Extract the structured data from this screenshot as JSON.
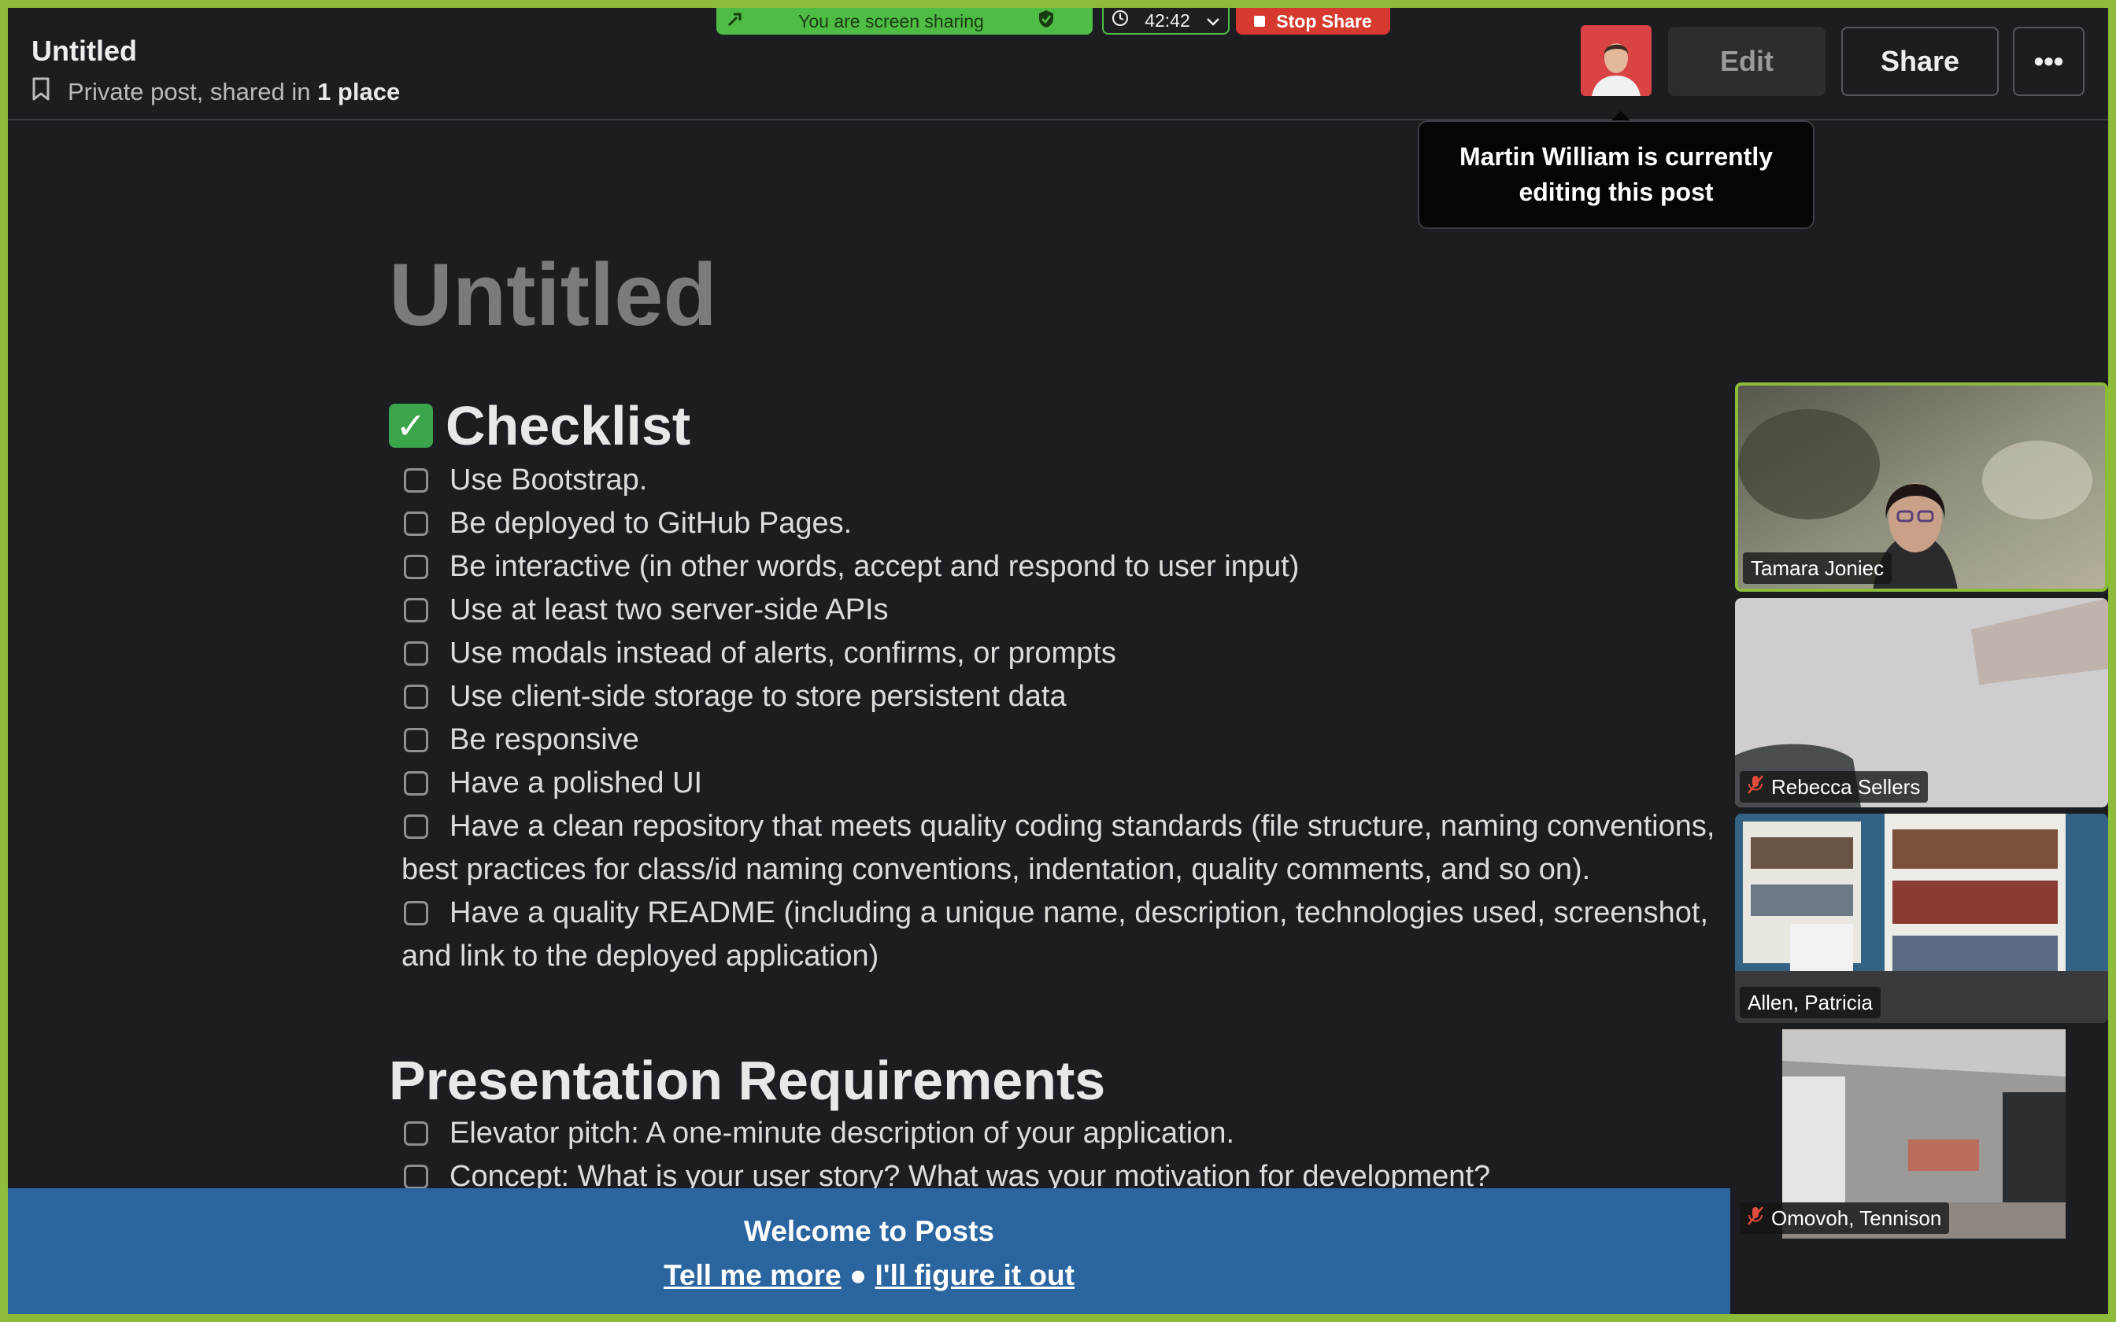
{
  "header": {
    "title": "Untitled",
    "subtitle_prefix": "Private post, shared in",
    "subtitle_bold": "1 place",
    "edit_label": "Edit",
    "share_label": "Share",
    "more_label": "•••"
  },
  "tooltip": {
    "text": "Martin William is currently editing this post"
  },
  "screen_share": {
    "status": "You are screen sharing",
    "timer": "42:42",
    "stop_label": "Stop Share"
  },
  "post": {
    "title": "Untitled",
    "sections": [
      {
        "heading": "Checklist",
        "items": [
          "Use Bootstrap.",
          "Be deployed to GitHub Pages.",
          "Be interactive (in other words, accept and respond to user input)",
          "Use at least two server-side APIs",
          "Use modals instead of alerts, confirms, or prompts",
          "Use client-side storage to store persistent data",
          "Be responsive",
          "Have a polished UI",
          "Have a clean repository that meets quality coding standards (file structure, naming conventions, best practices for class/id naming conventions, indentation, quality comments, and so on).",
          "Have a quality README (including a unique name, description, technologies used, screenshot, and link to the deployed application)"
        ]
      },
      {
        "heading": "Presentation Requirements",
        "items": [
          "Elevator pitch: A one-minute description of your application.",
          "Concept: What is your user story? What was your motivation for development?"
        ]
      }
    ]
  },
  "participants": [
    {
      "name": "Tamara Joniec",
      "muted": false,
      "active": true
    },
    {
      "name": "Rebecca Sellers",
      "muted": true,
      "active": false
    },
    {
      "name": "Allen, Patricia",
      "muted": false,
      "active": false
    },
    {
      "name": "Omovoh, Tennison",
      "muted": true,
      "active": false
    }
  ],
  "banner": {
    "title": "Welcome to Posts",
    "link_more": "Tell me more",
    "separator": "●",
    "link_dismiss": "I'll figure it out"
  },
  "colors": {
    "share_border": "#8cbc3a",
    "banner": "#2b65a0",
    "stop_share": "#d63a2e"
  }
}
